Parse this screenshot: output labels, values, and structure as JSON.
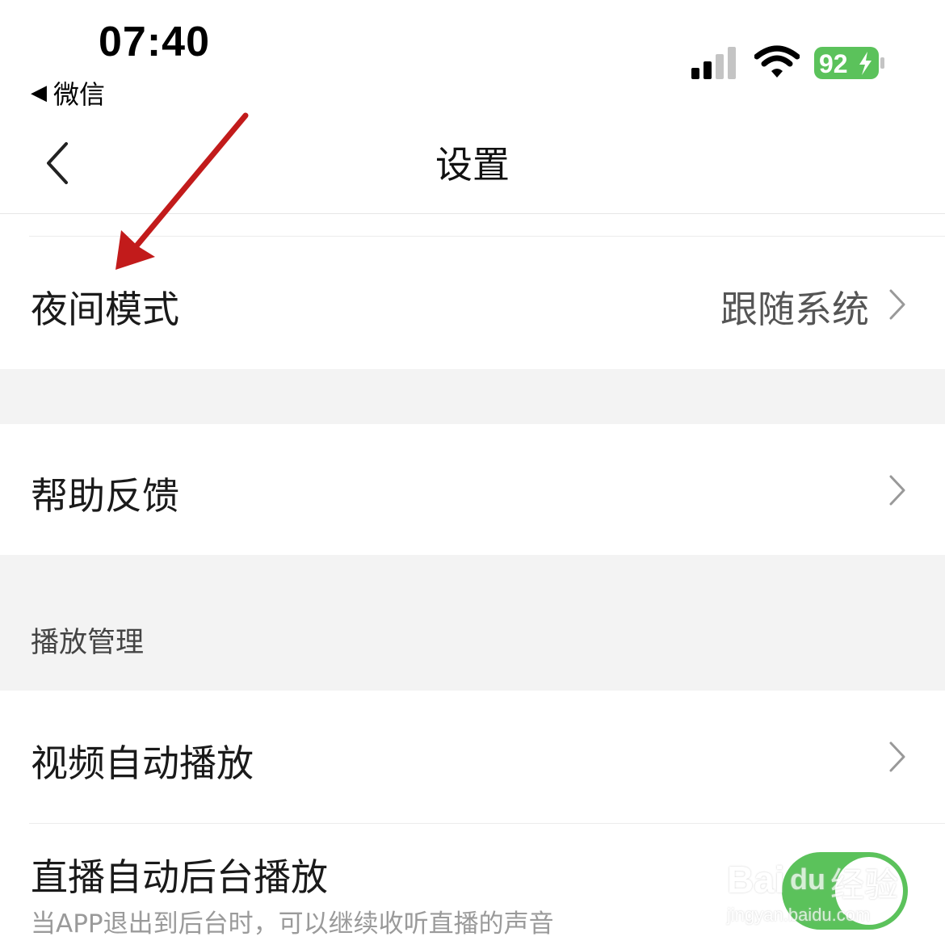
{
  "status_bar": {
    "time": "07:40",
    "back_app": "微信",
    "battery": "92"
  },
  "nav": {
    "title": "设置"
  },
  "rows": {
    "night_mode": {
      "label": "夜间模式",
      "value": "跟随系统"
    },
    "help_feedback": {
      "label": "帮助反馈"
    },
    "video_autoplay": {
      "label": "视频自动播放"
    },
    "live_background": {
      "label": "直播自动后台播放",
      "sublabel": "当APP退出到后台时，可以继续收听直播的声音",
      "enabled": true
    }
  },
  "sections": {
    "playback": "播放管理"
  },
  "colors": {
    "toggle_on": "#5bc25b",
    "battery": "#5bc25b",
    "annotation_arrow": "#c21b1b"
  },
  "watermark": {
    "brand": "Bai",
    "brand_du": "du",
    "suffix": "经验",
    "url": "jingyan.baidu.com"
  }
}
